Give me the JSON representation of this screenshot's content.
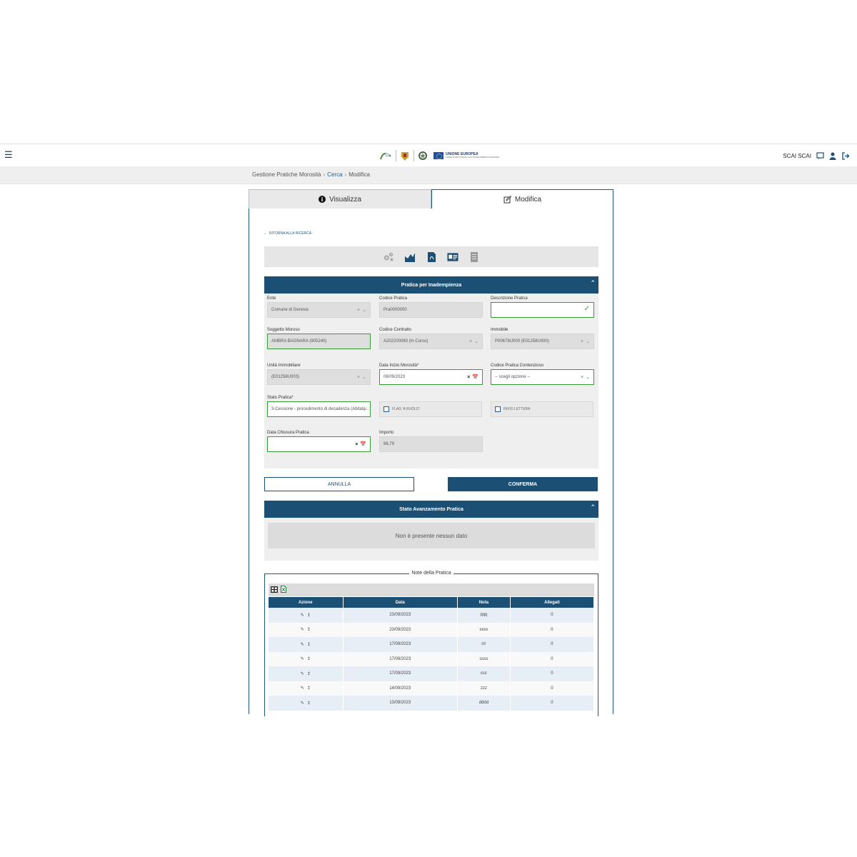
{
  "header": {
    "eu_title": "UNIONE EUROPEA",
    "eu_subtitle": "FONDI STRUTTURALI E DI INVESTIMENTO EUROPEI",
    "user_name": "SCAI SCAI",
    "icons": [
      "menu-icon",
      "region-logo",
      "city-crest-logo",
      "republic-emblem-logo",
      "eu-flag-logo",
      "chat-icon",
      "user-icon",
      "logout-icon"
    ]
  },
  "breadcrumb": {
    "items": [
      "Gestione Pratiche Morosità",
      "Cerca",
      "Modifica"
    ]
  },
  "tabs": [
    {
      "label": "Visualizza",
      "icon": "info-icon"
    },
    {
      "label": "Modifica",
      "icon": "edit-icon"
    }
  ],
  "back_link": "RITORNA ALLA RICERCA",
  "toolbar_icons": [
    "settings-icon",
    "chart-icon",
    "pdf-icon",
    "id-card-icon",
    "document-icon"
  ],
  "section_pratica": {
    "title": "Pratica per Inadempienza",
    "fields": {
      "ente": {
        "label": "Ente",
        "value": "Comune di Genova"
      },
      "codice_pratica": {
        "label": "Codice Pratica",
        "value": "Pra0000050"
      },
      "descrizione": {
        "label": "Descrizione Pratica",
        "value": ""
      },
      "soggetto": {
        "label": "Soggetto Moroso",
        "value": "AMBRA BAGNARA (905240)"
      },
      "codice_contratto": {
        "label": "Codice Contratto",
        "value": "A202200080 (In Corso)"
      },
      "immobile": {
        "label": "Immobile",
        "value": "P00678U000 (E01258U000)"
      },
      "unita": {
        "label": "Unità Immobiliare",
        "value": "(E01258U003)"
      },
      "data_inizio": {
        "label": "Data Inizio Morosità*",
        "value": "06/09/2023"
      },
      "codice_contenzioso": {
        "label": "Codice Pratica Contenzioso",
        "value": "-- scegli opzione --"
      },
      "stato": {
        "label": "Stato Pratica*",
        "value": "3-Cessione - procedimento di decadenza (Abitativ..."
      },
      "flag_ruolo": {
        "label": "FLAG 'A RUOLO'"
      },
      "invio_lettera": {
        "label": "INVIO LETTERA"
      },
      "data_chiusura": {
        "label": "Data Chiusura Pratica",
        "value": ""
      },
      "importo": {
        "label": "Importo",
        "value": "68,79"
      }
    }
  },
  "buttons": {
    "cancel": "ANNULLA",
    "confirm": "CONFERMA"
  },
  "section_stato": {
    "title": "Stato Avanzamento Pratica",
    "empty": "Non è presente nessun dato"
  },
  "notes": {
    "legend": "Note della Pratica",
    "columns": [
      "Azione",
      "Data",
      "Nota",
      "Allegati"
    ],
    "rows": [
      {
        "data": "23/09/2023",
        "nota": "qqq",
        "allegati": "0"
      },
      {
        "data": "23/09/2023",
        "nota": "xxxx",
        "allegati": "0"
      },
      {
        "data": "17/09/2023",
        "nota": "rrr",
        "allegati": "0"
      },
      {
        "data": "17/09/2023",
        "nota": "ssss",
        "allegati": "0"
      },
      {
        "data": "17/09/2023",
        "nota": "ccc",
        "allegati": "0"
      },
      {
        "data": "14/09/2023",
        "nota": "zzz",
        "allegati": "0"
      },
      {
        "data": "13/09/2023",
        "nota": "dddd",
        "allegati": "0"
      }
    ]
  },
  "colors": {
    "primary": "#1c4f74",
    "valid": "#3a9a3a",
    "link": "#1d5c87"
  }
}
